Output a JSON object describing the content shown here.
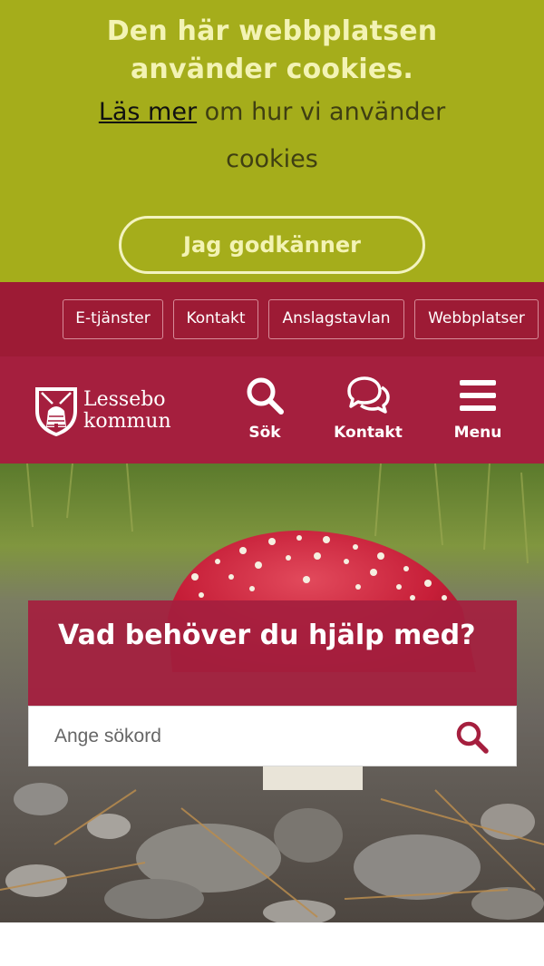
{
  "cookie_banner": {
    "title_line1": "Den här webbplatsen",
    "title_line2": "använder cookies.",
    "read_more_link": "Läs mer",
    "text_rest": " om hur vi använder cookies",
    "accept_button": "Jag godkänner",
    "colors": {
      "background": "#a5ad1b",
      "title": "#f3f3b4"
    }
  },
  "top_links": [
    "E-tjänster",
    "Kontakt",
    "Anslagstavlan",
    "Webbplatser"
  ],
  "header": {
    "logo_line1": "Lessebo",
    "logo_line2": "kommun",
    "search_label": "Sök",
    "contact_label": "Kontakt",
    "menu_label": "Menu",
    "colors": {
      "topbar": "#9d1b35",
      "header": "#a51f3e"
    },
    "icons": {
      "search": "search-icon",
      "contact": "chat-bubbles-icon",
      "menu": "hamburger-icon"
    }
  },
  "hero": {
    "help_title": "Vad behöver du hjälp med?",
    "search_placeholder": "Ange sökord",
    "image": "fly-agaric-mushroom-photo"
  }
}
